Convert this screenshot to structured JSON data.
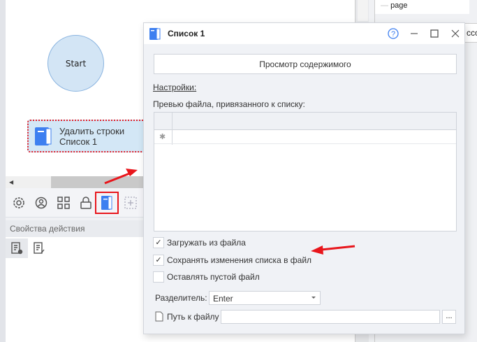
{
  "canvas": {
    "start_label": "Start",
    "node": {
      "line1": "Удалить строки",
      "line2": "Список 1"
    }
  },
  "props": {
    "header": "Свойства действия"
  },
  "right_panel": {
    "tree_item": "page",
    "input_fragment": "ccou"
  },
  "dialog": {
    "title": "Список 1",
    "view_button": "Просмотр содержимого",
    "settings_label": "Настройки:",
    "preview_label": "Превью файла, привязанного к списку:",
    "new_row_marker": "✱",
    "checkboxes": [
      {
        "label": "Загружать из файла",
        "checked": true
      },
      {
        "label": "Сохранять изменения списка в файл",
        "checked": true
      },
      {
        "label": "Оставлять пустой файл",
        "checked": false
      }
    ],
    "separator_label": "Разделитель:",
    "separator_value": "Enter",
    "path_label": "Путь к файлу",
    "path_value": "",
    "browse_label": "..."
  },
  "colors": {
    "accent": "#3d7ff0",
    "annotation": "#e8161c"
  }
}
